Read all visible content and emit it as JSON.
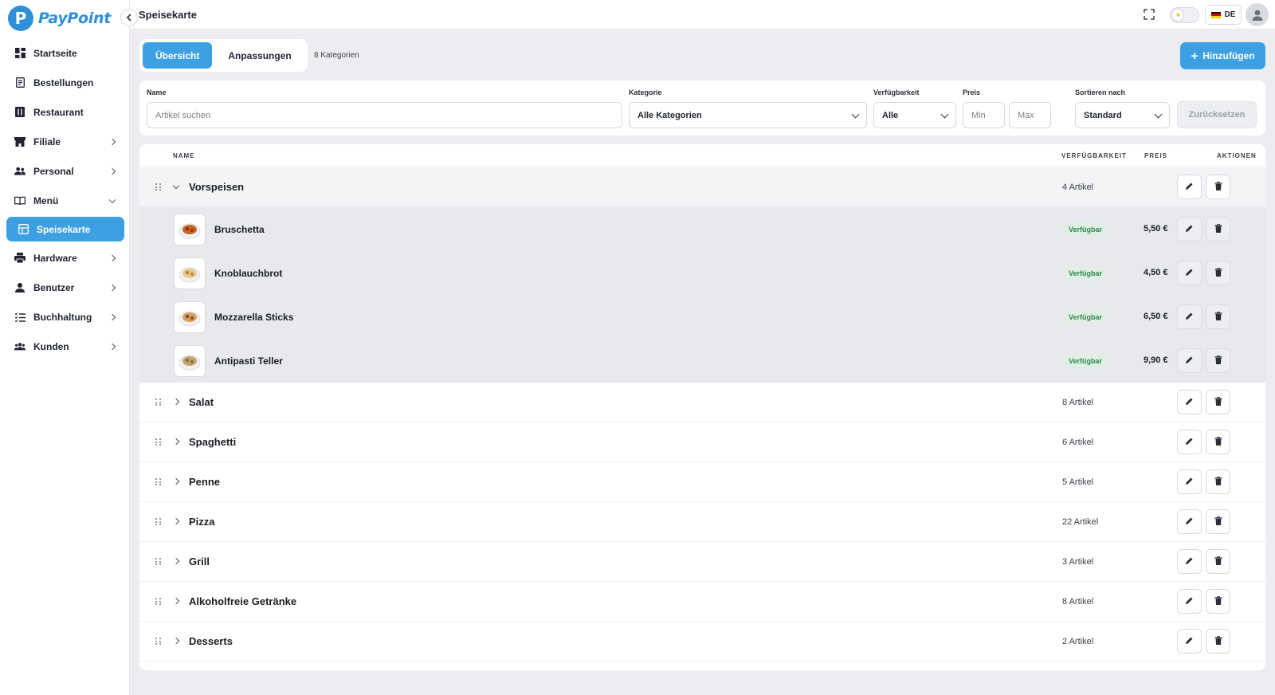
{
  "app": {
    "name": "PayPoint",
    "logo_letter": "P"
  },
  "topbar": {
    "title": "Speisekarte",
    "lang": "DE"
  },
  "sidebar": {
    "items": [
      {
        "label": "Startseite",
        "icon": "dashboard-icon",
        "chevron": "none"
      },
      {
        "label": "Bestellungen",
        "icon": "receipt-icon",
        "chevron": "none"
      },
      {
        "label": "Restaurant",
        "icon": "restaurant-icon",
        "chevron": "none"
      },
      {
        "label": "Filiale",
        "icon": "store-icon",
        "chevron": "right"
      },
      {
        "label": "Personal",
        "icon": "people-icon",
        "chevron": "right"
      },
      {
        "label": "Menü",
        "icon": "book-icon",
        "chevron": "down"
      },
      {
        "label": "Speisekarte",
        "icon": "grid-icon",
        "chevron": "none",
        "active": true
      },
      {
        "label": "Hardware",
        "icon": "printer-icon",
        "chevron": "right"
      },
      {
        "label": "Benutzer",
        "icon": "user-icon",
        "chevron": "right"
      },
      {
        "label": "Buchhaltung",
        "icon": "list-icon",
        "chevron": "right"
      },
      {
        "label": "Kunden",
        "icon": "group-icon",
        "chevron": "right"
      }
    ]
  },
  "tabs": [
    {
      "label": "Übersicht",
      "active": true
    },
    {
      "label": "Anpassungen",
      "active": false
    }
  ],
  "category_count": "8 Kategorien",
  "add_button": "Hinzufügen",
  "filters": {
    "name_label": "Name",
    "name_placeholder": "Artikel suchen",
    "category_label": "Kategorie",
    "category_value": "Alle Kategorien",
    "availability_label": "Verfügbarkeit",
    "availability_value": "Alle",
    "price_label": "Preis",
    "price_min_placeholder": "Min",
    "price_max_placeholder": "Max",
    "sort_label": "Sortieren nach",
    "sort_value": "Standard",
    "reset_label": "Zurücksetzen"
  },
  "table": {
    "headers": {
      "name": "NAME",
      "availability": "VERFÜGBARKEIT",
      "price": "PREIS",
      "actions": "AKTIONEN"
    },
    "categories": [
      {
        "name": "Vorspeisen",
        "count": "4 Artikel",
        "expanded": true,
        "items": [
          {
            "name": "Bruschetta",
            "status": "Verfügbar",
            "price": "5,50 €"
          },
          {
            "name": "Knoblauchbrot",
            "status": "Verfügbar",
            "price": "4,50 €"
          },
          {
            "name": "Mozzarella Sticks",
            "status": "Verfügbar",
            "price": "6,50 €"
          },
          {
            "name": "Antipasti Teller",
            "status": "Verfügbar",
            "price": "9,90 €"
          }
        ]
      },
      {
        "name": "Salat",
        "count": "8 Artikel",
        "expanded": false
      },
      {
        "name": "Spaghetti",
        "count": "6 Artikel",
        "expanded": false
      },
      {
        "name": "Penne",
        "count": "5 Artikel",
        "expanded": false
      },
      {
        "name": "Pizza",
        "count": "22 Artikel",
        "expanded": false
      },
      {
        "name": "Grill",
        "count": "3 Artikel",
        "expanded": false
      },
      {
        "name": "Alkoholfreie Getränke",
        "count": "8 Artikel",
        "expanded": false
      },
      {
        "name": "Desserts",
        "count": "2 Artikel",
        "expanded": false
      }
    ]
  },
  "colors": {
    "accent": "#3da0e3",
    "status_green": "#2e8a4a",
    "status_bg": "#e2eee5"
  }
}
